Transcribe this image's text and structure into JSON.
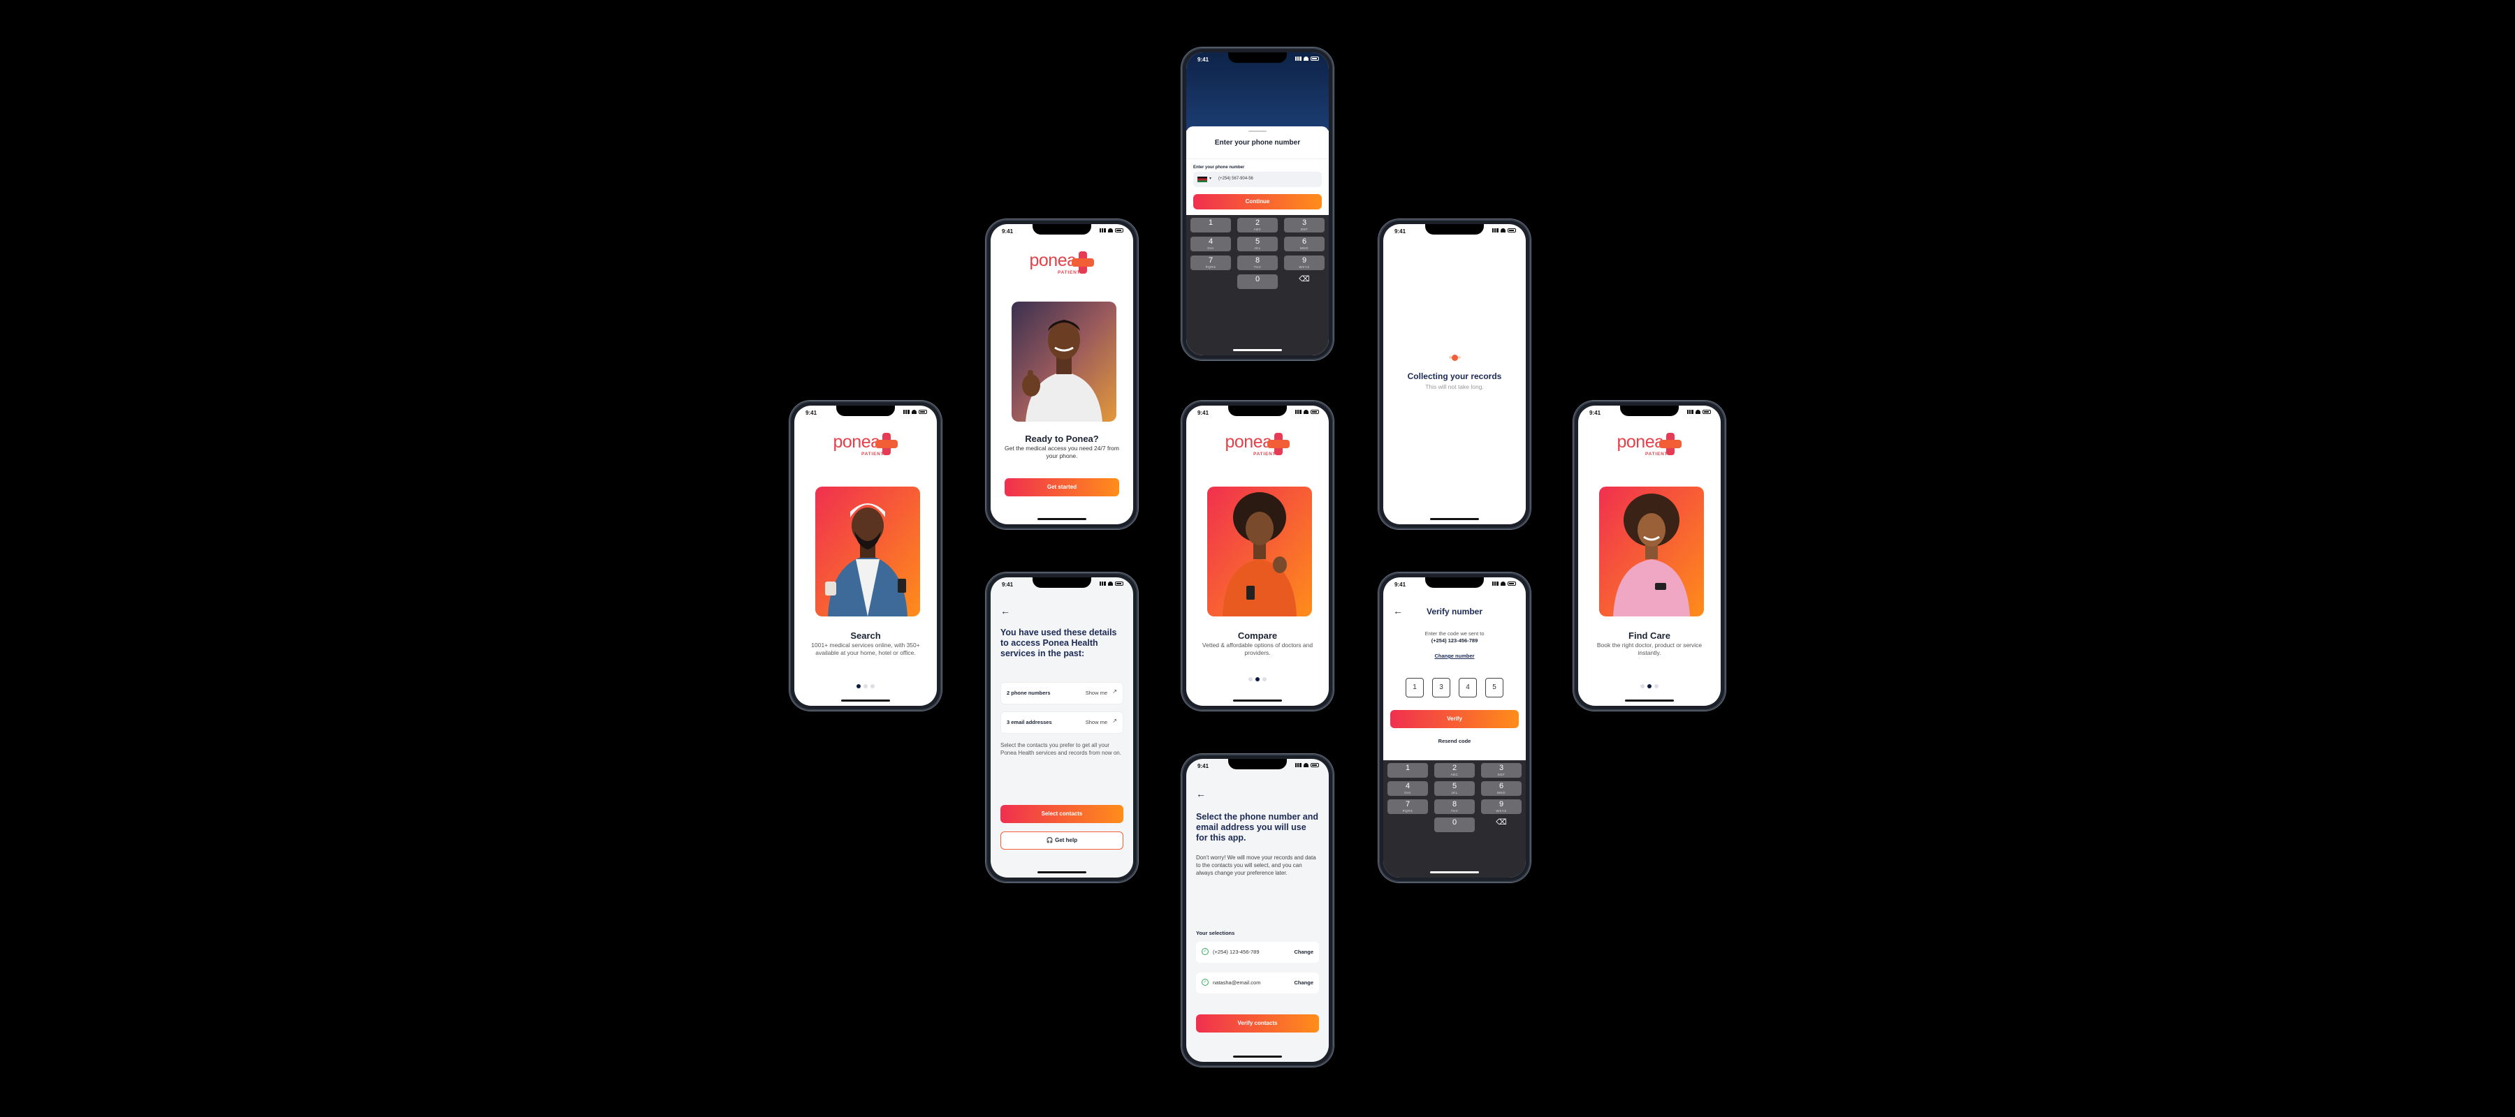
{
  "status_time": "9:41",
  "brand": {
    "name": "ponea",
    "sub": "PATIENT",
    "accent": "#f0304f",
    "accent2": "#ff8d1a",
    "navy": "#1c2a55"
  },
  "phone_entry": {
    "sheet_title": "Enter your phone number",
    "field_label": "Enter your phone number",
    "phone_value": "(+254) 567-904-56",
    "country_flag": "kenya-flag-icon",
    "continue_label": "Continue",
    "keys": [
      {
        "d": "1",
        "l": ""
      },
      {
        "d": "2",
        "l": "ABC"
      },
      {
        "d": "3",
        "l": "DEF"
      },
      {
        "d": "4",
        "l": "GHI"
      },
      {
        "d": "5",
        "l": "JKL"
      },
      {
        "d": "6",
        "l": "MNO"
      },
      {
        "d": "7",
        "l": "PQRS"
      },
      {
        "d": "8",
        "l": "TUV"
      },
      {
        "d": "9",
        "l": "WXYZ"
      },
      {
        "d": "0",
        "l": ""
      }
    ]
  },
  "ready": {
    "title": "Ready to Ponea?",
    "text": "Get the medical access you need 24/7 from your phone.",
    "button": "Get started"
  },
  "collecting": {
    "title": "Collecting your records",
    "text": "This will not take long."
  },
  "search": {
    "title": "Search",
    "text": "1001+ medical services online, with 350+ available at your home, hotel or office."
  },
  "compare": {
    "title": "Compare",
    "text": "Vetted & affordable options of doctors and providers."
  },
  "find_care": {
    "title": "Find Care",
    "text": "Book the right doctor, product or service instantly."
  },
  "used_details": {
    "title": "You have used these details to access Ponea Health services in the past:",
    "rows": [
      {
        "label": "2 phone numbers",
        "action": "Show me"
      },
      {
        "label": "3 email addresses",
        "action": "Show me"
      }
    ],
    "text": "Select the contacts you prefer to get all your Ponea Health services and records from now on.",
    "primary": "Select contacts",
    "secondary": "Get help"
  },
  "verify": {
    "title": "Verify number",
    "text": "Enter the code we sent to",
    "number": "(+254) 123-456-789",
    "change": "Change number",
    "code": [
      "1",
      "3",
      "4",
      "5"
    ],
    "button": "Verify",
    "resend": "Resend code",
    "keys": [
      {
        "d": "1",
        "l": ""
      },
      {
        "d": "2",
        "l": "ABC"
      },
      {
        "d": "3",
        "l": "DEF"
      },
      {
        "d": "4",
        "l": "GHI"
      },
      {
        "d": "5",
        "l": "JKL"
      },
      {
        "d": "6",
        "l": "MNO"
      },
      {
        "d": "7",
        "l": "PQRS"
      },
      {
        "d": "8",
        "l": "TUV"
      },
      {
        "d": "9",
        "l": "WXYZ"
      },
      {
        "d": "0",
        "l": ""
      }
    ]
  },
  "select_contacts": {
    "title": "Select the phone number and email address you will use for this app.",
    "text": "Don't worry! We will move your records and data to the contacts you will select, and you can always change your preference later.",
    "selections_label": "Your selections",
    "rows": [
      {
        "value": "(+254) 123-456-789",
        "action": "Change"
      },
      {
        "value": "natasha@email.com",
        "action": "Change"
      }
    ],
    "button": "Verify contacts"
  }
}
